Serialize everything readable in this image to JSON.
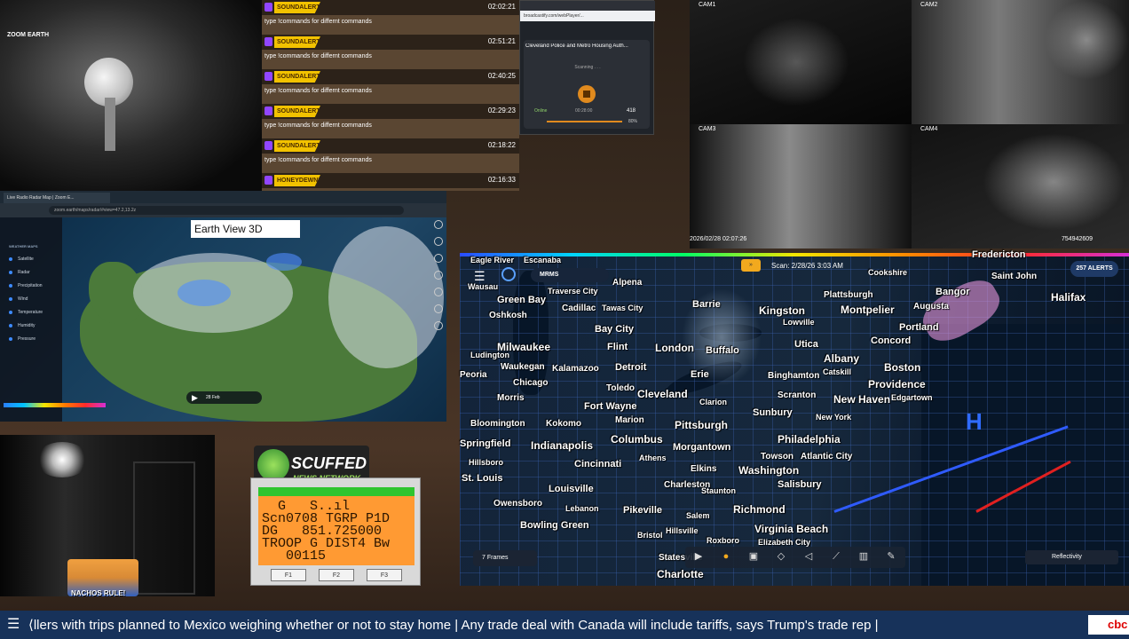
{
  "chat": {
    "rows": [
      {
        "badge": "SOUNDALERTS",
        "time": "02:02:21",
        "msg": "type !commands for differnt commands"
      },
      {
        "badge": "SOUNDALERTS",
        "time": "02:51:21",
        "msg": "type !commands for differnt commands"
      },
      {
        "badge": "SOUNDALERTS",
        "time": "02:40:25",
        "msg": "type !commands for differnt commands"
      },
      {
        "badge": "SOUNDALERTS",
        "time": "02:29:23",
        "msg": "type !commands for differnt commands"
      },
      {
        "badge": "SOUNDALERTS",
        "time": "02:18:22",
        "msg": "type !commands for differnt commands"
      },
      {
        "badge": "HONEYDEWNINJA",
        "time": "02:16:33",
        "msg": ""
      }
    ]
  },
  "radio": {
    "title": "Cleveland Police and Metro Housing Auth...",
    "status_text": "Scanning . . .",
    "online": "Online",
    "elapsed": "00:28:00",
    "listeners": "418",
    "volume": "80%",
    "address": "broadcastify.com/webPlayer/..."
  },
  "cameras": {
    "labels": [
      "CAM1",
      "CAM2",
      "CAM3",
      "CAM4"
    ],
    "timestamp": "2026/02/28 02:07:26",
    "device_id": "754942609"
  },
  "browser": {
    "tab_title": "Live Radio Radar Map | Zoom E...",
    "url": "zoom.earth/maps/radar/#view=47.2,13.2z",
    "earth_view": "Earth View 3D",
    "sidebar_title": "ZOOM EARTH",
    "sidebar_heading": "WEATHER MAPS",
    "sidebar_items": [
      "Satellite",
      "Radar",
      "Precipitation",
      "Wind",
      "Temperature",
      "Humidity",
      "Pressure"
    ],
    "play_date": "28 Feb"
  },
  "scanner": {
    "logo_line1": "SCUFFED",
    "logo_line2": "NEWS NETWORK",
    "lines": [
      "  G   S..ıl  ",
      "Scn0708 TGRP P1D",
      "DG   851.725000",
      "TROOP G DIST4 Bw",
      "   00115"
    ],
    "buttons": [
      "F1",
      "F2",
      "F3"
    ]
  },
  "overlay": {
    "nachos": "NACHOS RULE!"
  },
  "radar": {
    "scan_label": "Scan: 2/28/26 3:03 AM",
    "alerts": "257 ALERTS",
    "product": "MRMS",
    "frames": "7 Frames",
    "layer": "Reflectivity",
    "high_marker": "H",
    "cities": [
      {
        "name": "Eagle River"
      },
      {
        "name": "Escanaba"
      },
      {
        "name": "Alpena"
      },
      {
        "name": "Traverse City"
      },
      {
        "name": "Green Bay"
      },
      {
        "name": "Cadillac"
      },
      {
        "name": "Tawas City"
      },
      {
        "name": "Oshkosh"
      },
      {
        "name": "Wausau"
      },
      {
        "name": "Bay City"
      },
      {
        "name": "Milwaukee"
      },
      {
        "name": "Flint"
      },
      {
        "name": "Barrie"
      },
      {
        "name": "Kingston"
      },
      {
        "name": "London"
      },
      {
        "name": "Buffalo"
      },
      {
        "name": "Waukegan"
      },
      {
        "name": "Kalamazoo"
      },
      {
        "name": "Detroit"
      },
      {
        "name": "Chicago"
      },
      {
        "name": "Toledo"
      },
      {
        "name": "Erie"
      },
      {
        "name": "Cleveland"
      },
      {
        "name": "Fort Wayne"
      },
      {
        "name": "Morris"
      },
      {
        "name": "Marion"
      },
      {
        "name": "Pittsburgh"
      },
      {
        "name": "Kokomo"
      },
      {
        "name": "Bloomington"
      },
      {
        "name": "Columbus"
      },
      {
        "name": "Indianapolis"
      },
      {
        "name": "Springfield"
      },
      {
        "name": "Cincinnati"
      },
      {
        "name": "Athens"
      },
      {
        "name": "Morgantown"
      },
      {
        "name": "Elkins"
      },
      {
        "name": "Washington"
      },
      {
        "name": "Louisville"
      },
      {
        "name": "Charleston"
      },
      {
        "name": "Staunton"
      },
      {
        "name": "Richmond"
      },
      {
        "name": "Salisbury"
      },
      {
        "name": "Owensboro"
      },
      {
        "name": "Lebanon"
      },
      {
        "name": "Pikeville"
      },
      {
        "name": "Salem"
      },
      {
        "name": "Bowling Green"
      },
      {
        "name": "Bristol"
      },
      {
        "name": "Hillsville"
      },
      {
        "name": "Roxboro"
      },
      {
        "name": "Virginia Beach"
      },
      {
        "name": "Elizabeth City"
      },
      {
        "name": "Statesville"
      },
      {
        "name": "Charlotte"
      },
      {
        "name": "Plattsburgh"
      },
      {
        "name": "Montpelier"
      },
      {
        "name": "Bangor"
      },
      {
        "name": "Augusta"
      },
      {
        "name": "Portland"
      },
      {
        "name": "Concord"
      },
      {
        "name": "Albany"
      },
      {
        "name": "Boston"
      },
      {
        "name": "Providence"
      },
      {
        "name": "Binghamton"
      },
      {
        "name": "Scranton"
      },
      {
        "name": "New Haven"
      },
      {
        "name": "New York"
      },
      {
        "name": "Edgartown"
      },
      {
        "name": "Philadelphia"
      },
      {
        "name": "Atlantic City"
      },
      {
        "name": "Sunbury"
      },
      {
        "name": "Towson"
      },
      {
        "name": "Utica"
      },
      {
        "name": "Lowville"
      },
      {
        "name": "Cookshire"
      },
      {
        "name": "Fredericton"
      },
      {
        "name": "Saint John"
      },
      {
        "name": "Halifax"
      },
      {
        "name": "Catskill"
      },
      {
        "name": "Clarion"
      },
      {
        "name": "Peoria"
      },
      {
        "name": "Hillsboro"
      },
      {
        "name": "St. Louis"
      },
      {
        "name": "Ludington"
      }
    ]
  },
  "ticker": {
    "text": "⟨llers with trips planned to Mexico weighing whether or not to stay home   |   Any trade deal with Canada will include tariffs, says Trump's trade rep   |",
    "brand": "cbc"
  },
  "colors": {
    "ticker_bg": "#17325a",
    "badge": "#f2c200",
    "scanner_screen": "#ff9a33",
    "radar_accent": "#f2a91e"
  }
}
